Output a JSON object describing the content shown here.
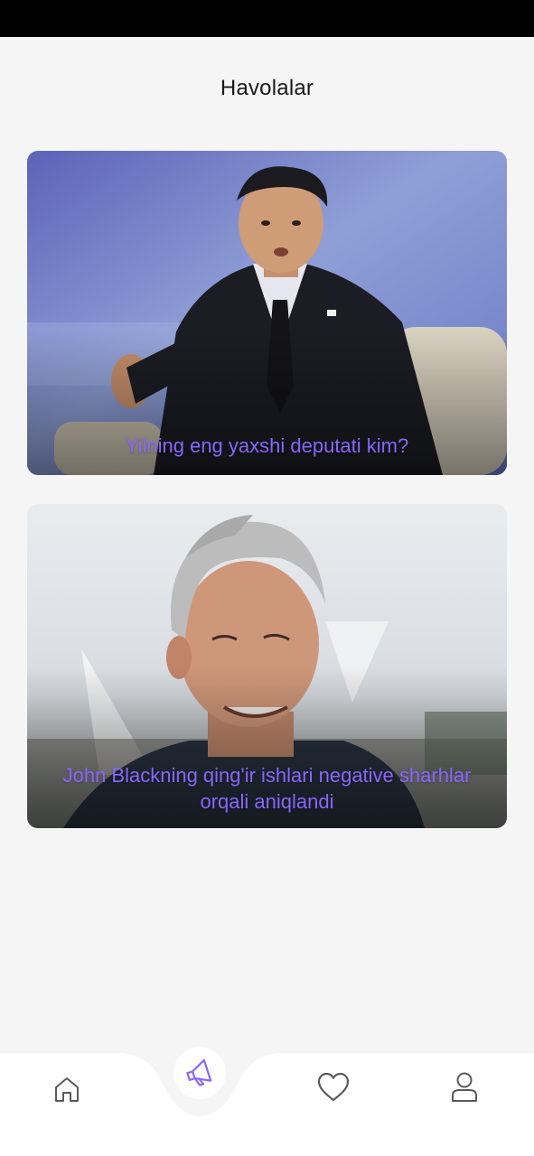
{
  "header": {
    "title": "Havolalar"
  },
  "cards": [
    {
      "caption": "Yilning eng yaxshi deputati kim?"
    },
    {
      "caption": "John Blackning qing'ir ishlari negative sharhlar orqali aniqlandi"
    }
  ],
  "bottom_nav": {
    "items": [
      {
        "icon": "home-icon",
        "active": false
      },
      {
        "icon": "megaphone-icon",
        "active": true
      },
      {
        "icon": "heart-icon",
        "active": false
      },
      {
        "icon": "user-icon",
        "active": false
      }
    ]
  },
  "colors": {
    "accent": "#8a66ff",
    "background": "#f5f5f5",
    "icon_inactive": "#5a5a5a"
  }
}
